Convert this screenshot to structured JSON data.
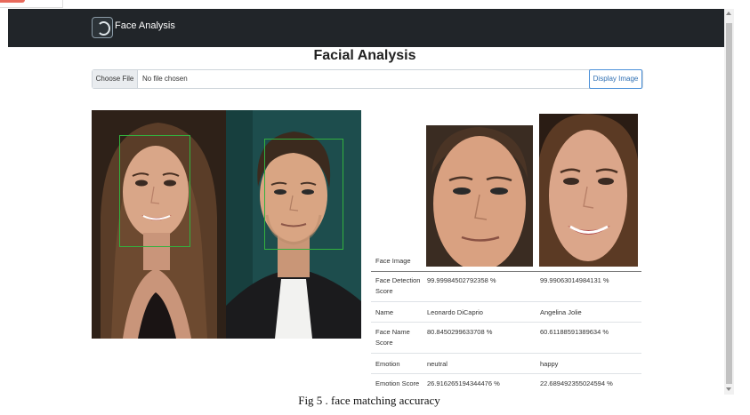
{
  "navbar": {
    "brand": "Face Analysis",
    "logo_icon": "face-scan-icon"
  },
  "page": {
    "title": "Facial Analysis"
  },
  "file_input": {
    "button_label": "Choose File",
    "status": "No file chosen"
  },
  "actions": {
    "display_image_label": "Display Image"
  },
  "results": {
    "face_image_label": "Face Image",
    "rows": [
      {
        "label": "Face Detection Score",
        "face1": "99.99984502792358 %",
        "face2": "99.99063014984131 %"
      },
      {
        "label": "Name",
        "face1": "Leonardo DiCaprio",
        "face2": "Angelina Jolie"
      },
      {
        "label": "Face Name Score",
        "face1": "80.8450299633708 %",
        "face2": "60.61188591389634 %"
      },
      {
        "label": "Emotion",
        "face1": "neutral",
        "face2": "happy"
      },
      {
        "label": "Emotion Score",
        "face1": "26.916265194344476 %",
        "face2": "22.689492355024594 %"
      }
    ]
  },
  "colors": {
    "navbar_bg": "#212529",
    "bbox": "#33b13e",
    "button_outline": "#4a90d9"
  },
  "caption": "Fig 5 . face matching accuracy"
}
